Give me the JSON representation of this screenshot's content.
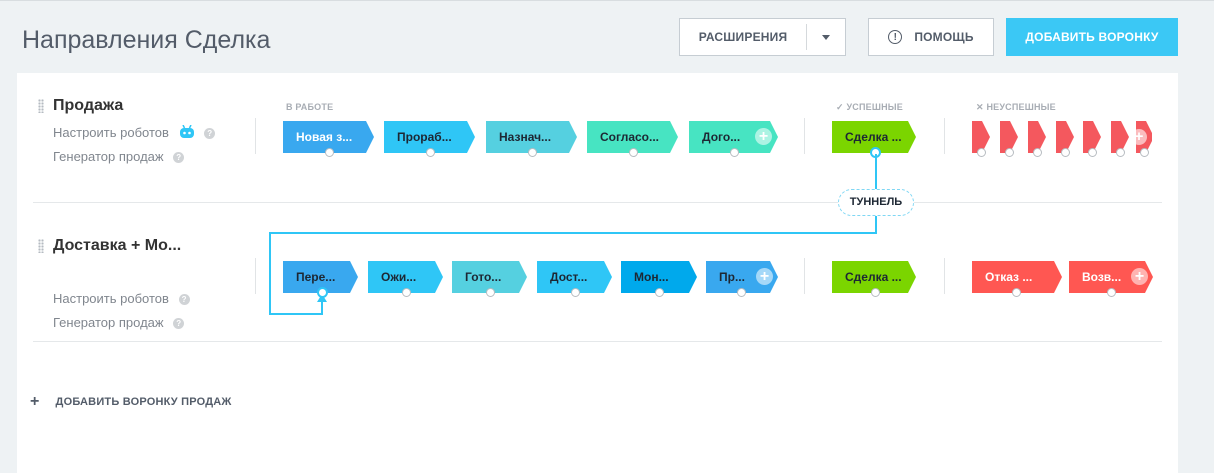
{
  "header": {
    "title": "Направления Сделка",
    "extensions_label": "РАСШИРЕНИЯ",
    "help_label": "ПОМОЩЬ",
    "add_funnel_label": "ДОБАВИТЬ ВОРОНКУ"
  },
  "groups": {
    "in_work": "В РАБОТЕ",
    "success": "УСПЕШНЫЕ",
    "fail": "НЕУСПЕШНЫЕ"
  },
  "funnels": [
    {
      "name": "Продажа",
      "robots_label": "Настроить роботов",
      "generator_label": "Генератор продаж",
      "stages": [
        {
          "label": "Новая з...",
          "color": "#39a8ef"
        },
        {
          "label": "Прораб...",
          "color": "#2fc6f6"
        },
        {
          "label": "Назнач...",
          "color": "#55d0e0"
        },
        {
          "label": "Согласо...",
          "color": "#47e4c2"
        },
        {
          "label": "Дого...",
          "color": "#47e4c2"
        }
      ],
      "success_stage": {
        "label": "Сделка ...",
        "color": "#7bd500"
      },
      "fail_color": "#ff5752"
    },
    {
      "name": "Доставка + Мо...",
      "robots_label": "Настроить роботов",
      "generator_label": "Генератор продаж",
      "stages": [
        {
          "label": "Пере...",
          "color": "#39a8ef"
        },
        {
          "label": "Ожи...",
          "color": "#2fc6f6"
        },
        {
          "label": "Гото...",
          "color": "#55d0e0"
        },
        {
          "label": "Дост...",
          "color": "#2fc6f6"
        },
        {
          "label": "Мон...",
          "color": "#00a9ec"
        },
        {
          "label": "Пр...",
          "color": "#39a8ef"
        }
      ],
      "success_stage": {
        "label": "Сделка ...",
        "color": "#7bd500"
      },
      "fail_stages": [
        {
          "label": "Отказ ...",
          "color": "#ff5752"
        },
        {
          "label": "Возв...",
          "color": "#ff5752"
        }
      ]
    }
  ],
  "tunnel_label": "ТУННЕЛЬ",
  "add_sales_funnel_label": "ДОБАВИТЬ ВОРОНКУ ПРОДАЖ"
}
